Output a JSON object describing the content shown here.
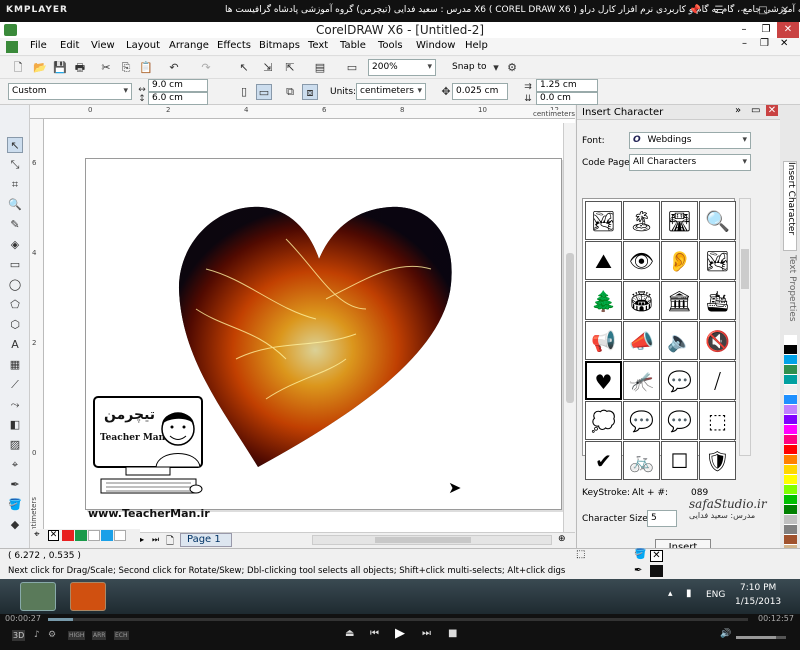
{
  "player": {
    "logo": "KMPLAYER",
    "title": "مجموعه آموزشی جامع ، گام به گام و کاربردی نرم افزار کارل دراو X6 ( COREL DRAW X6 ) مدرس : سعید فدایی (تیچرمن) گروه آموزشی پادشاه گرافیست ها",
    "time_elapsed": "00:00:27",
    "time_total": "00:12:57",
    "controls": [
      "3D",
      "HIGH",
      "ARR",
      "ECH"
    ]
  },
  "app": {
    "title": "CorelDRAW X6 - [Untitled-2]"
  },
  "menu": [
    "File",
    "Edit",
    "View",
    "Layout",
    "Arrange",
    "Effects",
    "Bitmaps",
    "Text",
    "Table",
    "Tools",
    "Window",
    "Help"
  ],
  "toolbar": {
    "zoom": "200%",
    "snap": "Snap to"
  },
  "propbar": {
    "page_size": "Custom",
    "width": "9.0 cm",
    "height": "6.0 cm",
    "units_label": "Units:",
    "units": "centimeters",
    "nudge": "0.025 cm",
    "dup_x": "1.25 cm",
    "dup_y": "0.0 cm"
  },
  "ruler": {
    "unit": "centimeters",
    "ticks": [
      "0",
      "2",
      "4",
      "6",
      "8",
      "10",
      "12"
    ],
    "v_ticks": [
      "6",
      "4",
      "2",
      "0"
    ],
    "v_unit": "centimeters"
  },
  "page": {
    "watermark_url": "www.TeacherMan.ir",
    "logo_text": "Teacher Man",
    "logo_persian": "تیچرمن"
  },
  "nav": {
    "page_count": "1 of 1",
    "page_tab": "Page 1"
  },
  "docker": {
    "title": "Insert Character",
    "font_label": "Font:",
    "font": "Webdings",
    "codepage_label": "Code Page:",
    "codepage": "All Characters",
    "keystroke_label": "KeyStroke:",
    "keystroke": "Alt + #:",
    "keycode": "089",
    "size_label": "Character Size:",
    "size_value": "5",
    "insert_label": "Insert",
    "side_tab_1": "Insert Character",
    "side_tab_2": "Text Properties",
    "watermark": "safaStudio.ir",
    "watermark2": "مدرس: سعید فدایی",
    "glyphs": [
      "🏞",
      "🏝",
      "🛣",
      "🔍",
      "⛰",
      "👁",
      "👂",
      "🏞",
      "🌲",
      "🏟",
      "🏛",
      "🛳",
      "📢",
      "📣",
      "🔈",
      "🔇",
      "♥",
      "🦟",
      "💬",
      "⧸",
      "💭",
      "💬",
      "💬",
      "⬚",
      "✔",
      "🚲",
      "☐",
      "🛡"
    ]
  },
  "status": {
    "coords": "( 6.272 , 0.535 )",
    "hint": "Next click for Drag/Scale; Second click for Rotate/Skew; Dbl-clicking tool selects all objects; Shift+click multi-selects; Alt+click digs"
  },
  "taskbar": {
    "lang": "ENG",
    "time": "7:10 PM",
    "date": "1/15/2013"
  },
  "palette": [
    "#ffffff",
    "#000000",
    "#00a2e8",
    "#2f8f4e",
    "#00a0a0",
    "#f0f0f0",
    "#1e90ff",
    "#c080ff",
    "#8000ff",
    "#ff00ff",
    "#ff0080",
    "#ff0000",
    "#ff8000",
    "#ffd700",
    "#ffff00",
    "#80ff00",
    "#00c000",
    "#008000",
    "#c0c0c0",
    "#808080",
    "#a0522d",
    "#d2b48c"
  ]
}
